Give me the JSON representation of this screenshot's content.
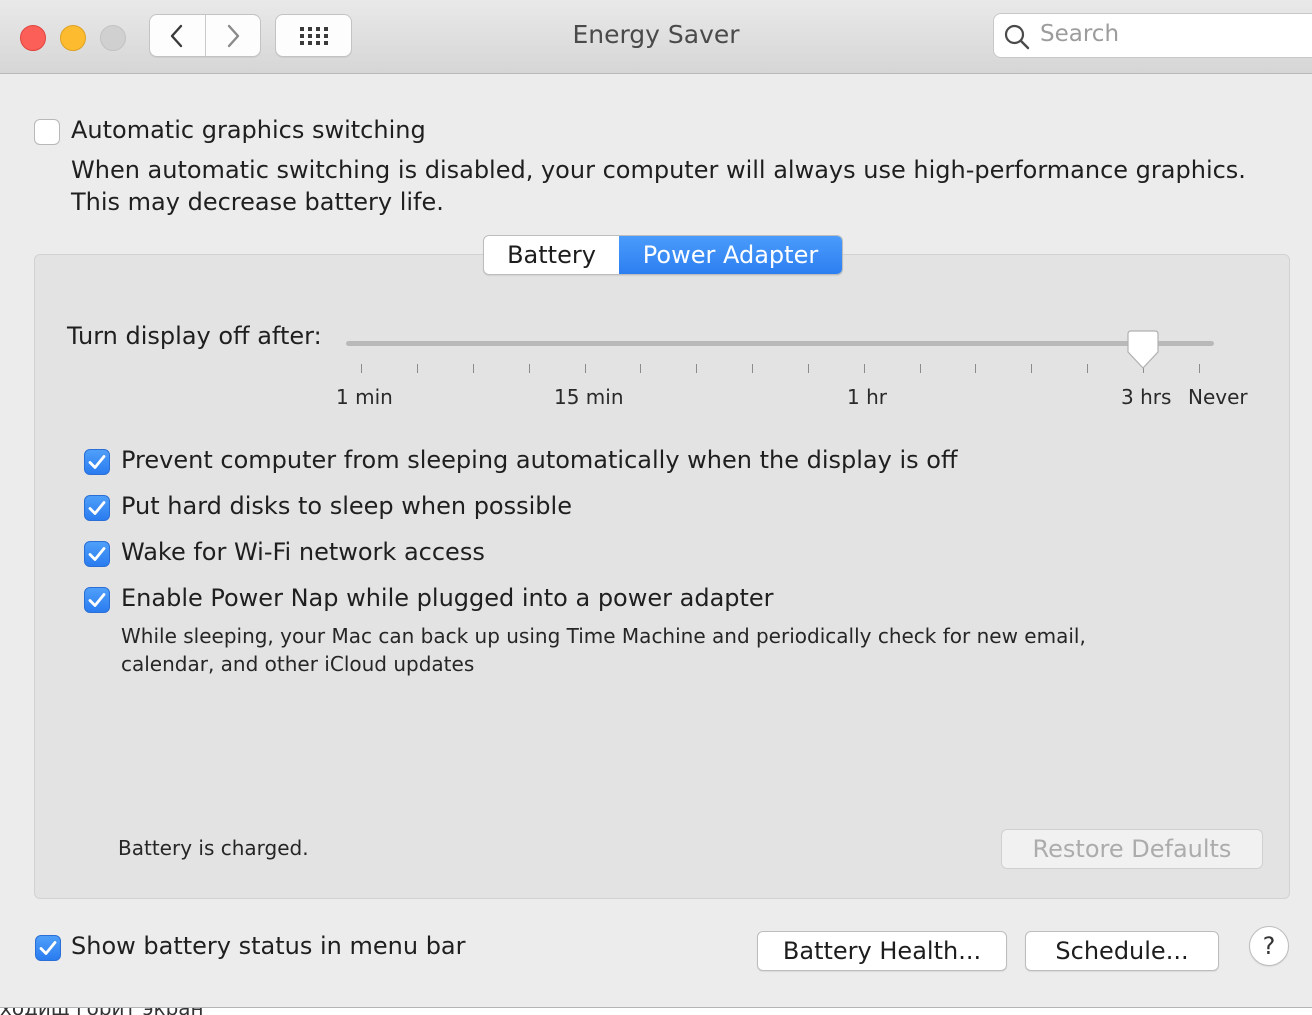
{
  "window": {
    "title": "Energy Saver",
    "search_placeholder": "Search"
  },
  "graphics": {
    "label": "Automatic graphics switching",
    "checked": false,
    "description_line1": "When automatic switching is disabled, your computer will always use high-performance graphics.",
    "description_line2": "This may decrease battery life."
  },
  "tabs": [
    {
      "label": "Battery",
      "selected": false
    },
    {
      "label": "Power Adapter",
      "selected": true
    }
  ],
  "display_sleep": {
    "label": "Turn display off after:",
    "tick_labels": [
      "1 min",
      "15 min",
      "1 hr",
      "3 hrs",
      "Never"
    ],
    "value": "3 hrs"
  },
  "options": [
    {
      "label": "Prevent computer from sleeping automatically when the display is off",
      "checked": true
    },
    {
      "label": "Put hard disks to sleep when possible",
      "checked": true
    },
    {
      "label": "Wake for Wi-Fi network access",
      "checked": true
    },
    {
      "label": "Enable Power Nap while plugged into a power adapter",
      "checked": true
    }
  ],
  "power_nap_note_line1": "While sleeping, your Mac can back up using Time Machine and periodically check for new email,",
  "power_nap_note_line2": "calendar, and other iCloud updates",
  "status": "Battery is charged.",
  "buttons": {
    "restore_defaults": "Restore Defaults",
    "battery_health": "Battery Health...",
    "schedule": "Schedule...",
    "help": "?"
  },
  "show_battery_status": {
    "label": "Show battery status in menu bar",
    "checked": true
  },
  "background_text": "ходищ   горит экран"
}
